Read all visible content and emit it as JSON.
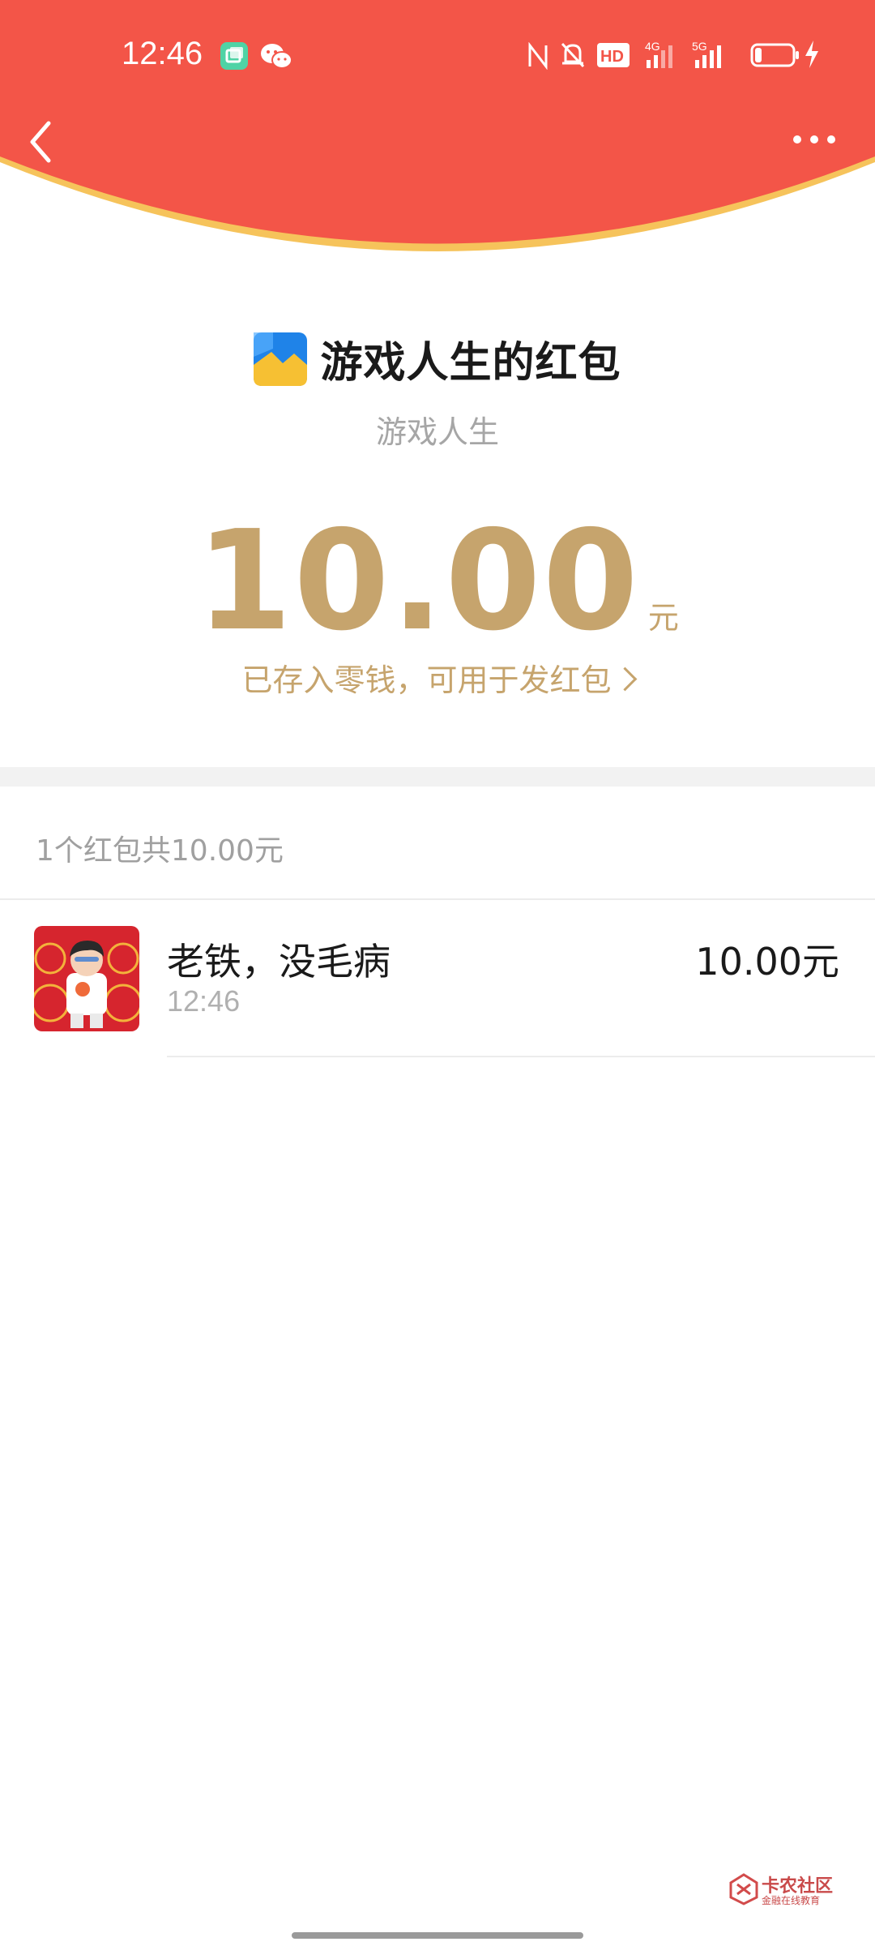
{
  "status_bar": {
    "time": "12:46",
    "icons": [
      "app-notification-icon",
      "wechat-icon",
      "nfc-icon",
      "silent-bell-icon",
      "hd-icon",
      "signal-4g-icon",
      "signal-5g-icon",
      "battery-icon",
      "charging-icon"
    ],
    "hd_label": "HD",
    "net1_label": "4G",
    "net2_label": "5G"
  },
  "colors": {
    "header_red": "#f35548",
    "header_edge": "#f6c35b",
    "gold": "#c6a46d"
  },
  "header": {
    "back_icon": "back-chevron-icon",
    "more_icon": "more-dots-icon"
  },
  "envelope": {
    "title": "游戏人生的红包",
    "sender": "游戏人生",
    "amount": "10.00",
    "unit": "元",
    "stored_link": "已存入零钱，可用于发红包"
  },
  "summary": "1个红包共10.00元",
  "records": [
    {
      "name": "老铁，没毛病",
      "time": "12:46",
      "amount": "10.00元"
    }
  ],
  "watermark": {
    "title": "卡农社区",
    "subtitle": "金融在线教育"
  }
}
